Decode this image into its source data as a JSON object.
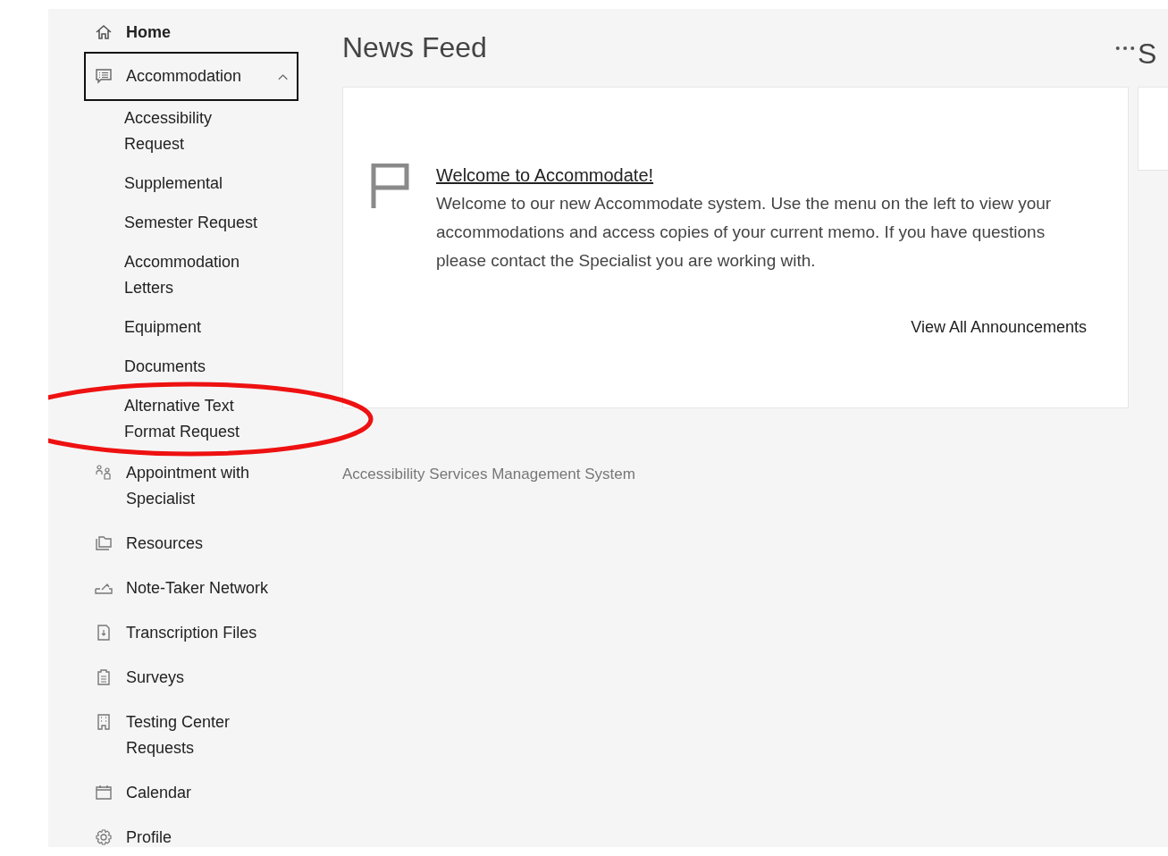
{
  "sidebar": {
    "items": [
      {
        "label": "Home",
        "kind": "home",
        "selected": false
      },
      {
        "label": "Accommodation",
        "kind": "chat",
        "selected": true,
        "expanded": true,
        "children": [
          {
            "label": "Accessibility Request",
            "selected": false,
            "circled": false
          },
          {
            "label": "Supplemental",
            "selected": false,
            "circled": false
          },
          {
            "label": "Semester Request",
            "selected": false,
            "circled": false
          },
          {
            "label": "Accommodation Letters",
            "selected": false,
            "circled": false
          },
          {
            "label": "Equipment",
            "selected": false,
            "circled": false
          },
          {
            "label": "Documents",
            "selected": false,
            "circled": false
          },
          {
            "label": "Alternative Text Format Request",
            "selected": false,
            "circled": true
          }
        ]
      },
      {
        "label": "Appointment with Specialist",
        "kind": "people",
        "selected": false
      },
      {
        "label": "Resources",
        "kind": "folder",
        "selected": false
      },
      {
        "label": "Note-Taker Network",
        "kind": "note",
        "selected": false
      },
      {
        "label": "Transcription Files",
        "kind": "file",
        "selected": false
      },
      {
        "label": "Surveys",
        "kind": "clipboard",
        "selected": false
      },
      {
        "label": "Testing Center Requests",
        "kind": "building",
        "selected": false
      },
      {
        "label": "Calendar",
        "kind": "calendar",
        "selected": false
      },
      {
        "label": "Profile",
        "kind": "gear",
        "selected": false
      }
    ]
  },
  "news_feed": {
    "title": "News Feed",
    "announcement": {
      "title": "Welcome to Accommodate!",
      "body": "Welcome to our new Accommodate system. Use the menu on the left to view your accommodations and access copies of your current memo. If you have questions please contact the Specialist you are working with."
    },
    "view_all": "View All Announcements"
  },
  "side_panel": {
    "title": "S"
  },
  "footer": "Accessibility Services Management System"
}
